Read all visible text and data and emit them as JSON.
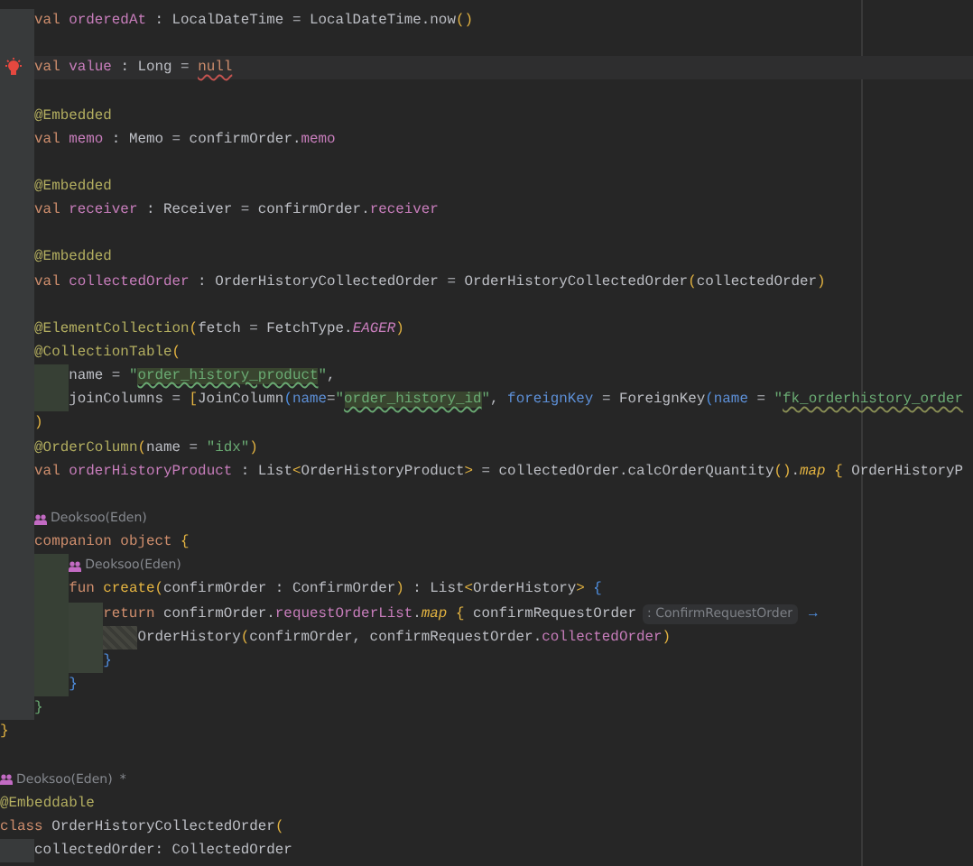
{
  "editor": {
    "lines": [
      {
        "kind": "group",
        "children": [
          {
            "kind": "code",
            "segments": [
              {
                "kind": "code",
                "tokens": [
                  {
                    "text": "val",
                    "kind": "keyword"
                  },
                  {
                    "text": " orderedAt",
                    "kind": "property"
                  },
                  {
                    "text": " : LocalDateTime = LocalDateTime.now",
                    "kind": "text"
                  },
                  {
                    "text": "()",
                    "kind": "bracket"
                  }
                ]
              }
            ]
          },
          {
            "kind": "blank"
          },
          {
            "kind": "code",
            "current": true,
            "intention": true,
            "segments": [
              {
                "kind": "code",
                "tokens": [
                  {
                    "text": "val",
                    "kind": "keyword"
                  },
                  {
                    "text": " value",
                    "kind": "property"
                  },
                  {
                    "text": " : Long = ",
                    "kind": "text"
                  },
                  {
                    "text": "null",
                    "kind": "error"
                  }
                ]
              }
            ]
          },
          {
            "kind": "blank"
          },
          {
            "kind": "code",
            "segments": [
              {
                "kind": "code",
                "tokens": [
                  {
                    "text": "@Embedded",
                    "kind": "annotation"
                  }
                ]
              }
            ]
          },
          {
            "kind": "code",
            "segments": [
              {
                "kind": "code",
                "tokens": [
                  {
                    "text": "val",
                    "kind": "keyword"
                  },
                  {
                    "text": " memo",
                    "kind": "property"
                  },
                  {
                    "text": " : Memo = confirmOrder.",
                    "kind": "text"
                  },
                  {
                    "text": "memo",
                    "kind": "property"
                  }
                ]
              }
            ]
          },
          {
            "kind": "blank"
          },
          {
            "kind": "code",
            "segments": [
              {
                "kind": "code",
                "tokens": [
                  {
                    "text": "@Embedded",
                    "kind": "annotation"
                  }
                ]
              }
            ]
          },
          {
            "kind": "code",
            "segments": [
              {
                "kind": "code",
                "tokens": [
                  {
                    "text": "val",
                    "kind": "keyword"
                  },
                  {
                    "text": " receiver",
                    "kind": "property"
                  },
                  {
                    "text": " : Receiver = confirmOrder.",
                    "kind": "text"
                  },
                  {
                    "text": "receiver",
                    "kind": "property"
                  }
                ]
              }
            ]
          },
          {
            "kind": "blank"
          },
          {
            "kind": "code",
            "segments": [
              {
                "kind": "code",
                "tokens": [
                  {
                    "text": "@Embedded",
                    "kind": "annotation"
                  }
                ]
              }
            ]
          },
          {
            "kind": "code",
            "segments": [
              {
                "kind": "code",
                "tokens": [
                  {
                    "text": "val",
                    "kind": "keyword"
                  },
                  {
                    "text": " collectedOrder",
                    "kind": "property"
                  },
                  {
                    "text": " : OrderHistoryCollectedOrder = OrderHistoryCollectedOrder",
                    "kind": "text"
                  },
                  {
                    "text": "(",
                    "kind": "bracket"
                  },
                  {
                    "text": "collectedOrder",
                    "kind": "text"
                  },
                  {
                    "text": ")",
                    "kind": "bracket"
                  }
                ]
              }
            ]
          },
          {
            "kind": "blank"
          },
          {
            "kind": "code",
            "segments": [
              {
                "kind": "code",
                "tokens": [
                  {
                    "text": "@ElementCollection",
                    "kind": "annotation"
                  },
                  {
                    "text": "(",
                    "kind": "bracket"
                  },
                  {
                    "text": "fetch = FetchType.",
                    "kind": "text"
                  },
                  {
                    "text": "EAGER",
                    "kind": "constant"
                  },
                  {
                    "text": ")",
                    "kind": "bracket"
                  }
                ]
              }
            ]
          },
          {
            "kind": "code",
            "segments": [
              {
                "kind": "code",
                "tokens": [
                  {
                    "text": "@CollectionTable",
                    "kind": "annotation"
                  },
                  {
                    "text": "(",
                    "kind": "bracket"
                  }
                ]
              }
            ],
            "children": [
              {
                "kind": "code",
                "segments": [
                  {
                    "kind": "code",
                    "tokens": [
                      {
                        "text": "name = ",
                        "kind": "text"
                      },
                      {
                        "text": "\"",
                        "kind": "string"
                      },
                      {
                        "text": "order_history_product",
                        "kind": "literal"
                      },
                      {
                        "text": "\"",
                        "kind": "string"
                      },
                      {
                        "text": ",",
                        "kind": "text"
                      }
                    ]
                  }
                ]
              },
              {
                "kind": "code",
                "segments": [
                  {
                    "kind": "code",
                    "tokens": [
                      {
                        "text": "joinColumns = ",
                        "kind": "text"
                      },
                      {
                        "text": "[",
                        "kind": "bracket"
                      },
                      {
                        "text": "JoinColumn",
                        "kind": "text"
                      },
                      {
                        "text": "(",
                        "kind": "brace"
                      },
                      {
                        "text": "name",
                        "kind": "argument"
                      },
                      {
                        "text": "=",
                        "kind": "text"
                      },
                      {
                        "text": "\"",
                        "kind": "string"
                      },
                      {
                        "text": "order_history_id",
                        "kind": "literal"
                      },
                      {
                        "text": "\"",
                        "kind": "string"
                      },
                      {
                        "text": ",",
                        "kind": "text"
                      },
                      {
                        "text": " foreignKey",
                        "kind": "argument"
                      },
                      {
                        "text": " = ForeignKey",
                        "kind": "text"
                      },
                      {
                        "text": "(",
                        "kind": "brace"
                      },
                      {
                        "text": "name",
                        "kind": "argument"
                      },
                      {
                        "text": " = ",
                        "kind": "text"
                      },
                      {
                        "text": "\"",
                        "kind": "string"
                      },
                      {
                        "text": "fk_orderhistory_order",
                        "kind": "warning"
                      }
                    ]
                  }
                ]
              }
            ]
          },
          {
            "kind": "code",
            "segments": [
              {
                "kind": "code",
                "tokens": [
                  {
                    "text": ")",
                    "kind": "bracket"
                  }
                ]
              }
            ]
          },
          {
            "kind": "code",
            "segments": [
              {
                "kind": "code",
                "tokens": [
                  {
                    "text": "@OrderColumn",
                    "kind": "annotation"
                  },
                  {
                    "text": "(",
                    "kind": "bracket"
                  },
                  {
                    "text": "name = ",
                    "kind": "text"
                  },
                  {
                    "text": "\"idx\"",
                    "kind": "string"
                  },
                  {
                    "text": ")",
                    "kind": "bracket"
                  }
                ]
              }
            ]
          },
          {
            "kind": "code",
            "segments": [
              {
                "kind": "code",
                "tokens": [
                  {
                    "text": "val",
                    "kind": "keyword"
                  },
                  {
                    "text": " orderHistoryProduct",
                    "kind": "property"
                  },
                  {
                    "text": " : List",
                    "kind": "text"
                  },
                  {
                    "text": "<",
                    "kind": "bracket"
                  },
                  {
                    "text": "OrderHistoryProduct",
                    "kind": "text"
                  },
                  {
                    "text": ">",
                    "kind": "bracket"
                  },
                  {
                    "text": " = collectedOrder.calcOrderQuantity",
                    "kind": "text"
                  },
                  {
                    "text": "()",
                    "kind": "bracket"
                  },
                  {
                    "text": ".",
                    "kind": "text"
                  },
                  {
                    "text": "map",
                    "kind": "extension"
                  },
                  {
                    "text": " {",
                    "kind": "bracket"
                  },
                  {
                    "text": " OrderHistoryP",
                    "kind": "text"
                  }
                ]
              }
            ]
          },
          {
            "kind": "blank"
          },
          {
            "kind": "author",
            "text": "Deoksoo(Eden)"
          },
          {
            "kind": "code",
            "segments": [
              {
                "kind": "code",
                "tokens": [
                  {
                    "text": "companion object",
                    "kind": "keyword"
                  },
                  {
                    "text": " {",
                    "kind": "bracket"
                  }
                ]
              }
            ],
            "children": [
              {
                "kind": "author",
                "text": "Deoksoo(Eden)"
              },
              {
                "kind": "code",
                "segments": [
                  {
                    "kind": "code",
                    "tokens": [
                      {
                        "text": "fun",
                        "kind": "keyword"
                      },
                      {
                        "text": " create",
                        "kind": "function"
                      },
                      {
                        "text": "(",
                        "kind": "bracket"
                      },
                      {
                        "text": "confirmOrder : ConfirmOrder",
                        "kind": "text"
                      },
                      {
                        "text": ")",
                        "kind": "bracket"
                      },
                      {
                        "text": " : List",
                        "kind": "text"
                      },
                      {
                        "text": "<",
                        "kind": "bracket"
                      },
                      {
                        "text": "OrderHistory",
                        "kind": "text"
                      },
                      {
                        "text": ">",
                        "kind": "bracket"
                      },
                      {
                        "text": " {",
                        "kind": "brace"
                      }
                    ]
                  }
                ],
                "children": [
                  {
                    "kind": "code",
                    "segments": [
                      {
                        "kind": "code",
                        "tokens": [
                          {
                            "text": "return",
                            "kind": "keyword"
                          },
                          {
                            "text": " confirmOrder.",
                            "kind": "text"
                          },
                          {
                            "text": "requestOrderList",
                            "kind": "property"
                          },
                          {
                            "text": ".",
                            "kind": "text"
                          },
                          {
                            "text": "map",
                            "kind": "extension"
                          },
                          {
                            "text": " {",
                            "kind": "bracket"
                          },
                          {
                            "text": " confirmRequestOrder",
                            "kind": "text"
                          }
                        ]
                      },
                      {
                        "kind": "hint",
                        "text": ": ConfirmRequestOrder"
                      },
                      {
                        "kind": "code",
                        "tokens": [
                          {
                            "text": "→",
                            "kind": "brace"
                          }
                        ]
                      }
                    ],
                    "children": [
                      {
                        "kind": "code",
                        "segments": [
                          {
                            "kind": "code",
                            "tokens": [
                              {
                                "text": "OrderHistory",
                                "kind": "text"
                              },
                              {
                                "text": "(",
                                "kind": "bracket"
                              },
                              {
                                "text": "confirmOrder, confirmRequestOrder.",
                                "kind": "text"
                              },
                              {
                                "text": "collectedOrder",
                                "kind": "property"
                              },
                              {
                                "text": ")",
                                "kind": "bracket"
                              }
                            ]
                          }
                        ]
                      }
                    ]
                  },
                  {
                    "kind": "code",
                    "segments": [
                      {
                        "kind": "code",
                        "tokens": [
                          {
                            "text": "}",
                            "kind": "brace"
                          }
                        ]
                      }
                    ]
                  }
                ]
              },
              {
                "kind": "code",
                "segments": [
                  {
                    "kind": "code",
                    "tokens": [
                      {
                        "text": "}",
                        "kind": "brace"
                      }
                    ]
                  }
                ]
              }
            ]
          },
          {
            "kind": "code",
            "segments": [
              {
                "kind": "code",
                "tokens": [
                  {
                    "text": "}",
                    "kind": "block"
                  }
                ]
              }
            ]
          }
        ]
      },
      {
        "kind": "code",
        "segments": [
          {
            "kind": "code",
            "tokens": [
              {
                "text": "}",
                "kind": "bracket"
              }
            ]
          }
        ]
      },
      {
        "kind": "blank"
      },
      {
        "kind": "author",
        "text": "Deoksoo(Eden)",
        "modified_mark": "*"
      },
      {
        "kind": "code",
        "segments": [
          {
            "kind": "code",
            "tokens": [
              {
                "text": "@Embeddable",
                "kind": "annotation"
              }
            ]
          }
        ]
      },
      {
        "kind": "code",
        "segments": [
          {
            "kind": "code",
            "tokens": [
              {
                "text": "class",
                "kind": "keyword"
              },
              {
                "text": " OrderHistoryCollectedOrder",
                "kind": "text"
              },
              {
                "text": "(",
                "kind": "bracket"
              }
            ]
          }
        ],
        "children": [
          {
            "kind": "code",
            "segments": [
              {
                "kind": "code",
                "tokens": [
                  {
                    "text": "collectedOrder: CollectedOrder",
                    "kind": "text"
                  }
                ]
              }
            ]
          }
        ]
      }
    ]
  }
}
